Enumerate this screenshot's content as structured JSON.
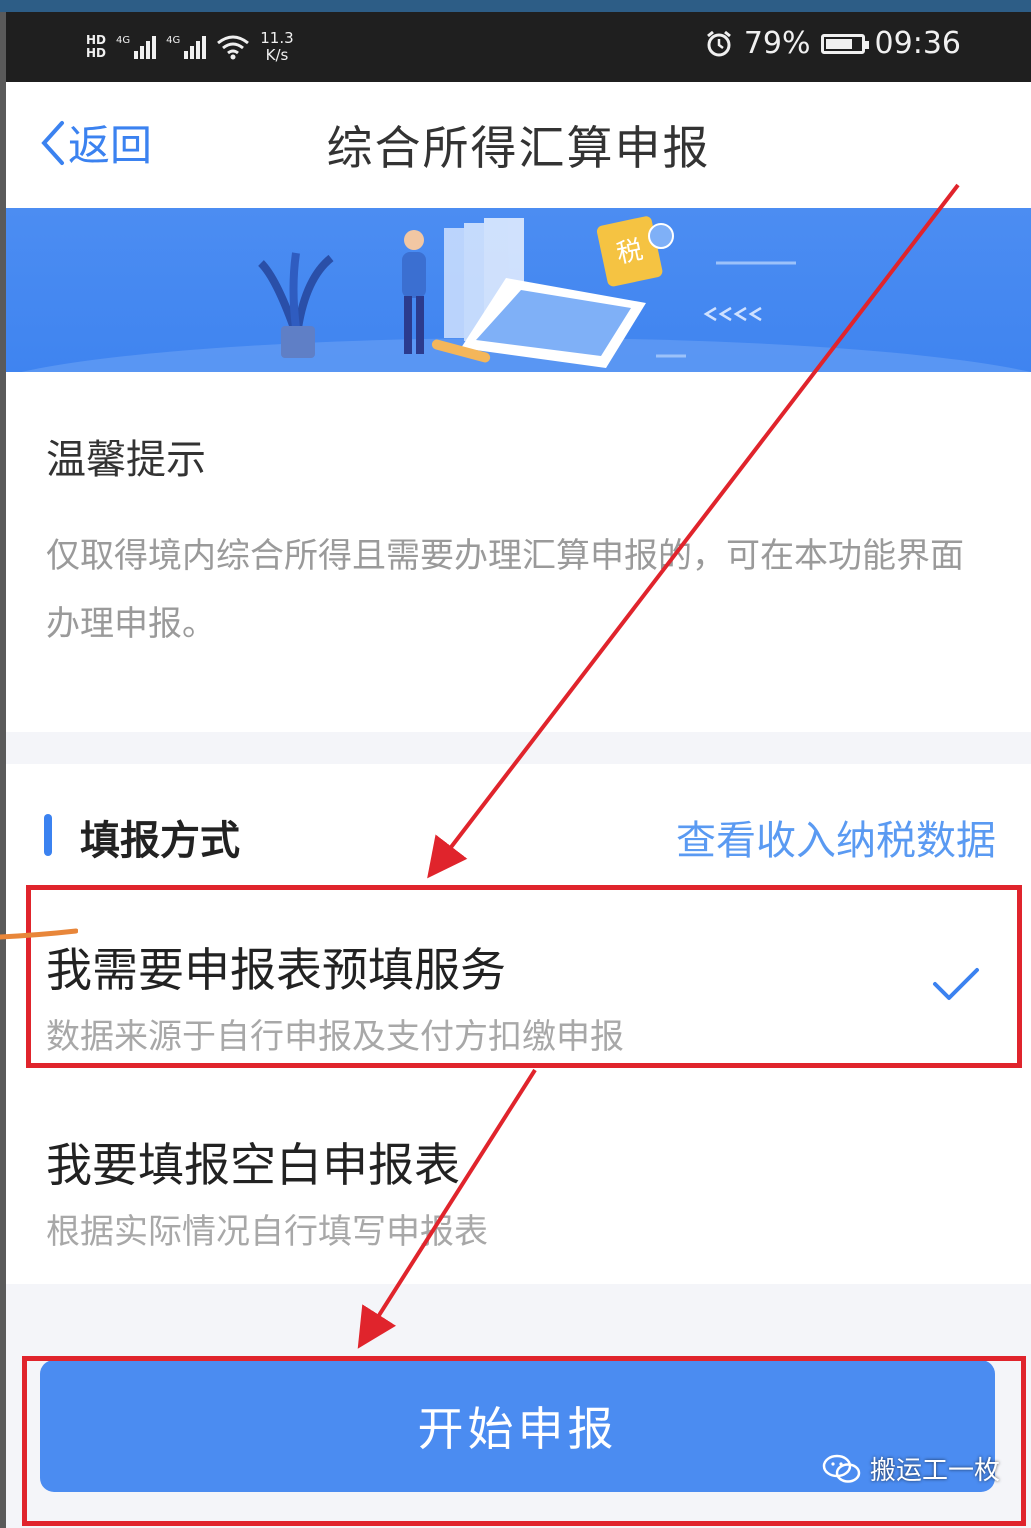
{
  "status_bar": {
    "hd1": "HD",
    "hd2": "HD",
    "net1": "4G",
    "net2": "4G",
    "speed_value": "11.3",
    "speed_unit": "K/s",
    "battery_percent": "79%",
    "battery_level": 0.79,
    "time": "09:36"
  },
  "nav": {
    "back_label": "返回",
    "title": "综合所得汇算申报"
  },
  "banner": {
    "tax_badge": "税"
  },
  "tips": {
    "title": "温馨提示",
    "text": "仅取得境内综合所得且需要办理汇算申报的，可在本功能界面办理申报。"
  },
  "fill_method": {
    "title": "填报方式",
    "link_label": "查看收入纳税数据",
    "options": [
      {
        "title": "我需要申报表预填服务",
        "subtitle": "数据来源于自行申报及支付方扣缴申报",
        "selected": true
      },
      {
        "title": "我要填报空白申报表",
        "subtitle": "根据实际情况自行填写申报表",
        "selected": false
      }
    ]
  },
  "start_button_label": "开始申报",
  "watermark": "搬运工一枚",
  "colors": {
    "accent": "#3b82f0",
    "button": "#4b8cf1",
    "annotation": "#e0242c"
  }
}
